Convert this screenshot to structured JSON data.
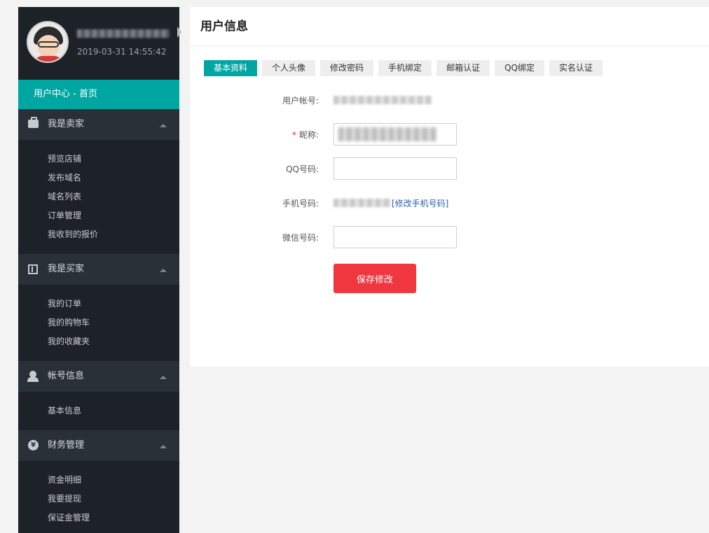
{
  "profile": {
    "username": "",
    "time": "2019-03-31 14:55:42"
  },
  "sidebar": {
    "home_label": "用户中心 - 首页",
    "sections": [
      {
        "title": "我是卖家",
        "icon": "briefcase-icon",
        "items": [
          "预览店铺",
          "发布域名",
          "域名列表",
          "订单管理",
          "我收到的报价"
        ]
      },
      {
        "title": "我是买家",
        "icon": "book-icon",
        "items": [
          "我的订单",
          "我的购物车",
          "我的收藏夹"
        ]
      },
      {
        "title": "帐号信息",
        "icon": "user-icon",
        "items": [
          "基本信息"
        ]
      },
      {
        "title": "财务管理",
        "icon": "coin-icon",
        "items": [
          "资金明细",
          "我要提现",
          "保证金管理"
        ]
      }
    ]
  },
  "main": {
    "title": "用户信息",
    "tabs": [
      "基本资料",
      "个人头像",
      "修改密码",
      "手机绑定",
      "邮箱认证",
      "QQ绑定",
      "实名认证"
    ],
    "active_tab": 0,
    "form": {
      "account_label": "用户帐号:",
      "nickname_required": "*",
      "nickname_label": "昵称:",
      "qq_label": "QQ号码:",
      "qq_value": "",
      "phone_label": "手机号码:",
      "phone_link": "[修改手机号码]",
      "wechat_label": "微信号码:",
      "wechat_value": ""
    },
    "save_label": "保存修改"
  },
  "colors": {
    "accent": "#00a7a2",
    "sidebar_bg": "#1d2229",
    "section_bg": "#2a3038",
    "save_button": "#f0363e",
    "link": "#2a5fb0"
  }
}
